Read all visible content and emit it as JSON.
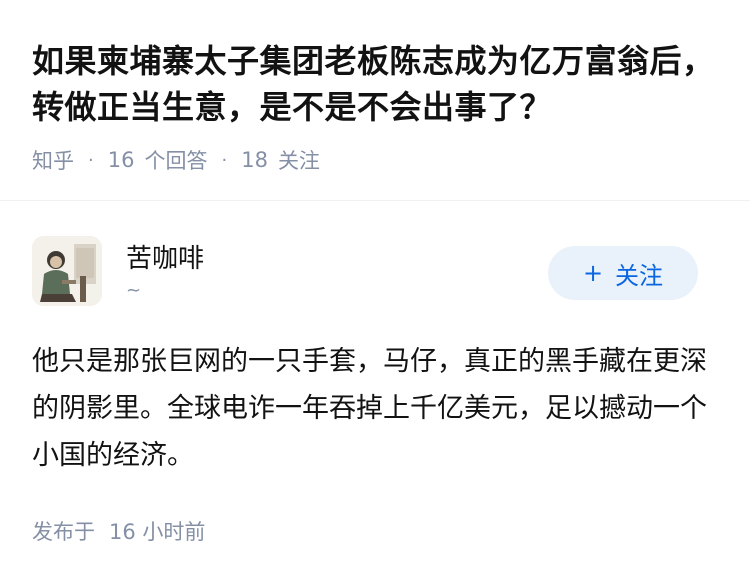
{
  "question": {
    "title": "如果柬埔寨太子集团老板陈志成为亿万富翁后，转做正当生意，是不是不会出事了？"
  },
  "meta": {
    "source": "知乎",
    "answers_count": "16",
    "answers_label": "个回答",
    "followers_count": "18",
    "followers_label": "关注"
  },
  "author": {
    "name": "苦咖啡",
    "subtitle": "~",
    "follow_icon": "+",
    "follow_label": "关注"
  },
  "answer": {
    "text": "他只是那张巨网的一只手套，马仔，真正的黑手藏在更深的阴影里。全球电诈一年吞掉上千亿美元，足以撼动一个小国的经济。"
  },
  "footer": {
    "published_label": "发布于",
    "published_time": "16 小时前"
  },
  "colors": {
    "accent": "#0a66e0",
    "follow_bg": "#e9f1fb",
    "meta_text": "#8590a6",
    "body_text": "#121212"
  }
}
